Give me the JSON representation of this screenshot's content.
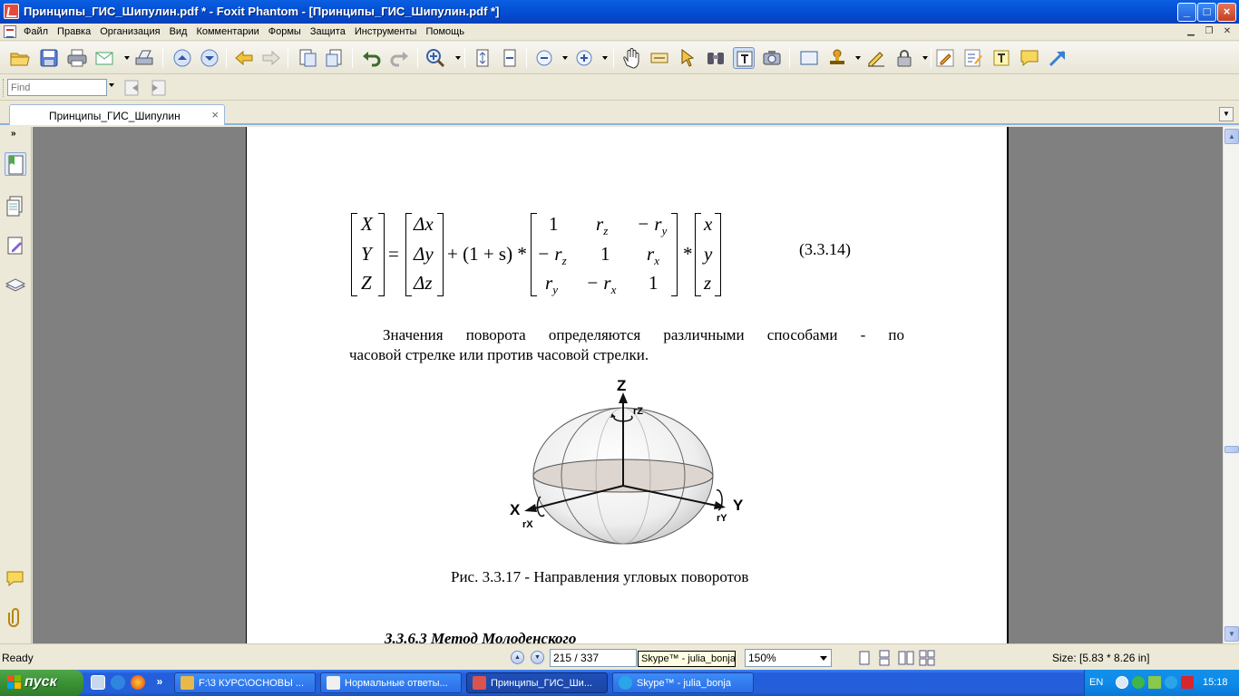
{
  "window": {
    "title": "Принципы_ГИС_Шипулин.pdf * - Foxit Phantom - [Принципы_ГИС_Шипулин.pdf *]",
    "minimize": "_",
    "maximize": "□",
    "close": "×"
  },
  "menu": {
    "items": [
      "Файл",
      "Правка",
      "Организация",
      "Вид",
      "Комментарии",
      "Формы",
      "Защита",
      "Инструменты",
      "Помощь"
    ]
  },
  "find": {
    "placeholder": "Find"
  },
  "tab": {
    "label": "Принципы_ГИС_Шипулин",
    "close": "×"
  },
  "document": {
    "formula": {
      "lhs": [
        "X",
        "Y",
        "Z"
      ],
      "translation": [
        "Δx",
        "Δy",
        "Δz"
      ],
      "scale": "+ (1 + s) *",
      "rotation": [
        [
          "1",
          "r_z",
          "− r_y"
        ],
        [
          "− r_z",
          "1",
          "r_x"
        ],
        [
          "r_y",
          "− r_x",
          "1"
        ]
      ],
      "vector": [
        "x",
        "y",
        "z"
      ],
      "equals": "=",
      "times": "*",
      "number": "(3.3.14)"
    },
    "paragraph": {
      "line1": "Значения поворота определяются различными способами - по",
      "line2": "часовой стрелке или против часовой стрелки."
    },
    "figure": {
      "axis_z": "Z",
      "axis_x": "X",
      "axis_y": "Y",
      "rot_z": "rZ",
      "rot_x": "rX",
      "rot_y": "rY"
    },
    "caption": "Рис. 3.3.17 - Направления угловых поворотов",
    "heading": "3.3.6.3 Метод Молоденского"
  },
  "status": {
    "ready": "Ready",
    "page": "215 / 337",
    "zoom": "150%",
    "size": "Size: [5.83 * 8.26 in]",
    "tooltip": "Skype™ - julia_bonja"
  },
  "taskbar": {
    "start": "пуск",
    "tasks": [
      {
        "label": "F:\\3 КУРС\\ОСНОВЫ ...",
        "color": "#e8b84a"
      },
      {
        "label": "Нормальные ответы...",
        "color": "#f0f0f0"
      },
      {
        "label": "Принципы_ГИС_Ши...",
        "color": "#d9534f"
      },
      {
        "label": "Skype™ - julia_bonja",
        "color": "#2aa6e8"
      }
    ],
    "lang": "EN",
    "clock": "15:18"
  }
}
